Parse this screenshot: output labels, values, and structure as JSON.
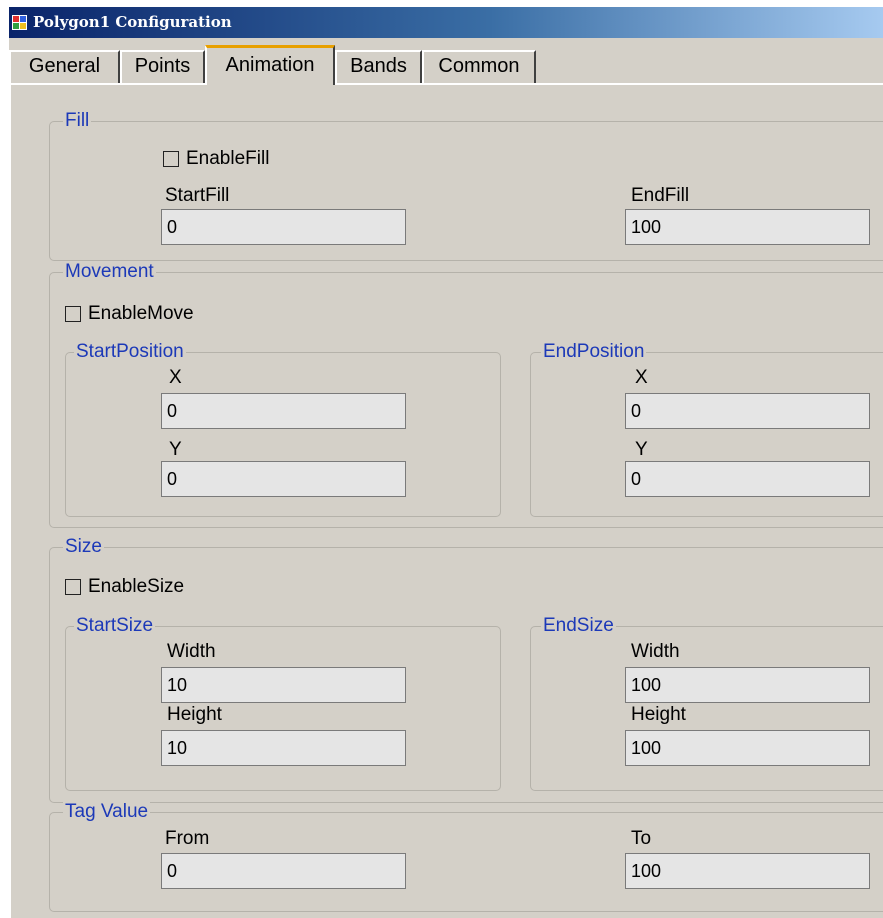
{
  "window": {
    "title": "Polygon1 Configuration"
  },
  "tabs": [
    {
      "label": "General"
    },
    {
      "label": "Points"
    },
    {
      "label": "Animation",
      "active": true
    },
    {
      "label": "Bands"
    },
    {
      "label": "Common"
    }
  ],
  "fill": {
    "legend": "Fill",
    "enable_label": "EnableFill",
    "enabled": false,
    "start_label": "StartFill",
    "start_value": "0",
    "end_label": "EndFill",
    "end_value": "100"
  },
  "movement": {
    "legend": "Movement",
    "enable_label": "EnableMove",
    "enabled": false,
    "start": {
      "legend": "StartPosition",
      "x_label": "X",
      "x_value": "0",
      "y_label": "Y",
      "y_value": "0"
    },
    "end": {
      "legend": "EndPosition",
      "x_label": "X",
      "x_value": "0",
      "y_label": "Y",
      "y_value": "0"
    }
  },
  "size": {
    "legend": "Size",
    "enable_label": "EnableSize",
    "enabled": false,
    "start": {
      "legend": "StartSize",
      "width_label": "Width",
      "width_value": "10",
      "height_label": "Height",
      "height_value": "10"
    },
    "end": {
      "legend": "EndSize",
      "width_label": "Width",
      "width_value": "100",
      "height_label": "Height",
      "height_value": "100"
    }
  },
  "tag_value": {
    "legend": "Tag Value",
    "from_label": "From",
    "from_value": "0",
    "to_label": "To",
    "to_value": "100"
  }
}
